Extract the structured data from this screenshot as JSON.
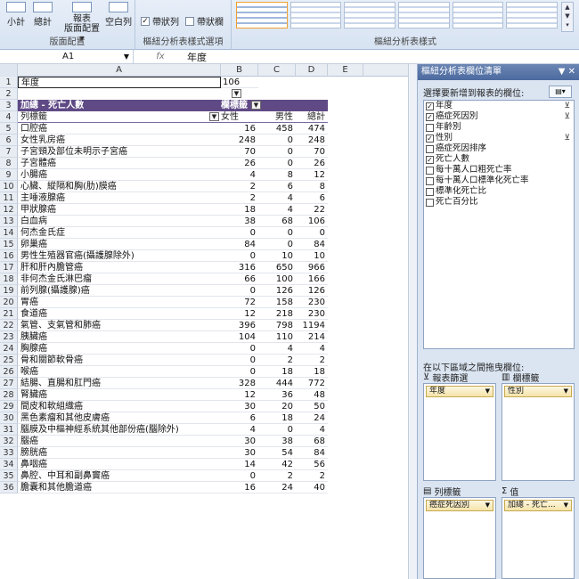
{
  "ribbon": {
    "buttons": [
      {
        "name": "subtotals-button",
        "label": "小計"
      },
      {
        "name": "grand-totals-button",
        "label": "總計"
      },
      {
        "name": "report-layout-button",
        "label": "報表\n版面配置 ▾"
      },
      {
        "name": "blank-rows-button",
        "label": "空白列"
      }
    ],
    "group_layout": "版面配置",
    "options": [
      {
        "name": "banded-rows-checkbox",
        "label": "帶狀列",
        "checked": true
      },
      {
        "name": "banded-columns-checkbox",
        "label": "帶狀欄",
        "checked": false
      }
    ],
    "group_options": "樞紐分析表樣式選項",
    "group_styles": "樞紐分析表樣式"
  },
  "formula_bar": {
    "cell_ref": "A1",
    "fx": "fx",
    "value": "年度"
  },
  "columns": [
    "A",
    "B",
    "C",
    "D",
    "E"
  ],
  "cell_A1": "年度",
  "cell_B1": "106",
  "pivot": {
    "title": "加總 - 死亡人數",
    "col_label": "欄標籤",
    "row_label": "列標籤",
    "female": "女性",
    "male": "男性",
    "total": "總計",
    "rows": [
      [
        "口腔癌",
        "16",
        "458",
        "474"
      ],
      [
        "女性乳房癌",
        "248",
        "0",
        "248"
      ],
      [
        "子宮頸及部位未明示子宮癌",
        "70",
        "0",
        "70"
      ],
      [
        "子宮體癌",
        "26",
        "0",
        "26"
      ],
      [
        "小腸癌",
        "4",
        "8",
        "12"
      ],
      [
        "心臟、縱隔和胸(肋)膜癌",
        "2",
        "6",
        "8"
      ],
      [
        "主唾液腺癌",
        "2",
        "4",
        "6"
      ],
      [
        "甲狀腺癌",
        "18",
        "4",
        "22"
      ],
      [
        "白血病",
        "38",
        "68",
        "106"
      ],
      [
        "何杰金氏症",
        "0",
        "0",
        "0"
      ],
      [
        "卵巢癌",
        "84",
        "0",
        "84"
      ],
      [
        "男性生殖器官癌(攝護腺除外)",
        "0",
        "10",
        "10"
      ],
      [
        "肝和肝內膽管癌",
        "316",
        "650",
        "966"
      ],
      [
        "非何杰金氏淋巴瘤",
        "66",
        "100",
        "166"
      ],
      [
        "前列腺(攝護腺)癌",
        "0",
        "126",
        "126"
      ],
      [
        "胃癌",
        "72",
        "158",
        "230"
      ],
      [
        "食道癌",
        "12",
        "218",
        "230"
      ],
      [
        "氣管、支氣管和肺癌",
        "396",
        "798",
        "1194"
      ],
      [
        "胰臟癌",
        "104",
        "110",
        "214"
      ],
      [
        "胸腺癌",
        "0",
        "4",
        "4"
      ],
      [
        "骨和關節軟骨癌",
        "0",
        "2",
        "2"
      ],
      [
        "喉癌",
        "0",
        "18",
        "18"
      ],
      [
        "結腸、直腸和肛門癌",
        "328",
        "444",
        "772"
      ],
      [
        "腎臟癌",
        "12",
        "36",
        "48"
      ],
      [
        "間皮和軟組織癌",
        "30",
        "20",
        "50"
      ],
      [
        "黑色素瘤和其他皮膚癌",
        "6",
        "18",
        "24"
      ],
      [
        "腦膜及中樞神經系統其他部份癌(腦除外)",
        "4",
        "0",
        "4"
      ],
      [
        "腦癌",
        "30",
        "38",
        "68"
      ],
      [
        "膀胱癌",
        "30",
        "54",
        "84"
      ],
      [
        "鼻咽癌",
        "14",
        "42",
        "56"
      ],
      [
        "鼻腔、中耳和副鼻竇癌",
        "0",
        "2",
        "2"
      ],
      [
        "膽囊和其他膽道癌",
        "16",
        "24",
        "40"
      ]
    ]
  },
  "panel": {
    "title": "樞紐分析表欄位清單",
    "choose_label": "選擇要新增到報表的欄位:",
    "fields": [
      {
        "label": "年度",
        "checked": true,
        "filter": true
      },
      {
        "label": "癌症死因別",
        "checked": true,
        "filter": true
      },
      {
        "label": "年齡別",
        "checked": false,
        "filter": false
      },
      {
        "label": "性別",
        "checked": true,
        "filter": true
      },
      {
        "label": "癌症死因排序",
        "checked": false,
        "filter": false
      },
      {
        "label": "死亡人數",
        "checked": true,
        "filter": false
      },
      {
        "label": "每十萬人口粗死亡率",
        "checked": false,
        "filter": false
      },
      {
        "label": "每十萬人口標準化死亡率",
        "checked": false,
        "filter": false
      },
      {
        "label": "標準化死亡比",
        "checked": false,
        "filter": false
      },
      {
        "label": "死亡百分比",
        "checked": false,
        "filter": false
      }
    ],
    "drag_label": "在以下區域之間拖曳欄位:",
    "zone_filter": "報表篩選",
    "zone_columns": "欄標籤",
    "zone_rows": "列標籤",
    "zone_values": "值",
    "sigma": "Σ",
    "chip_filter": "年度",
    "chip_columns": "性別",
    "chip_rows": "癌症死因別",
    "chip_values": "加總 - 死亡..."
  }
}
